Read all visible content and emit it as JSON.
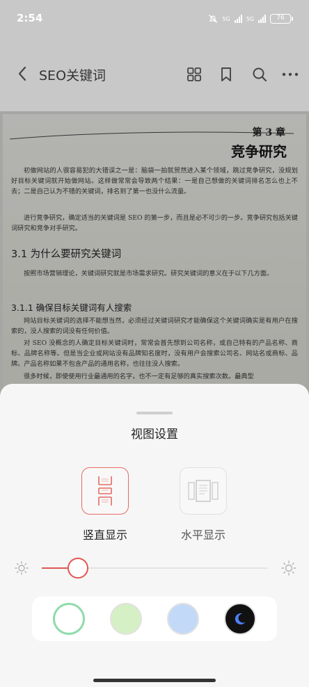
{
  "status": {
    "time": "2:54",
    "net1": "5G",
    "net2": "5G",
    "battery": "76"
  },
  "toolbar": {
    "title": "SEO关键词"
  },
  "book": {
    "chapter_num": "第 3 章",
    "chapter_title": "竞争研究",
    "para1": "初做网站的人很容易犯的大错误之一是：脑袋一拍就贸然进入某个领域，跳过竞争研究，没规划好目标关键词就开始做网站。这样做常常会导致两个结果：一是自己想做的关键词排名怎么也上不去；二是自己认为不错的关键词，排名到了第一也没什么流量。",
    "para2": "进行竞争研究，确定适当的关键词是 SEO 的第一步，而且是必不可少的一步。竞争研究包括关键词研究和竞争对手研究。",
    "h2": "3.1  为什么要研究关键词",
    "para3": "按照市场营销理论，关键词研究就是市场需求研究。研究关键词的意义在于以下几方面。",
    "h3": "3.1.1  确保目标关键词有人搜索",
    "para4": "网站目标关键词的选择不能想当然，必须经过关键词研究才能确保这个关键词确实是有用户在搜索的，没人搜索的词没有任何价值。",
    "para5": "对 SEO 没概念的人确定目标关键词时，常常会首先想到公司名称，或自己特有的产品名称、商标、品牌名称等。但是当企业或网站没有品牌知名度时，没有用户会搜索公司名、网站名或商标、品牌。产品名称如果不包含产品的通用名称，也往往没人搜索。",
    "para6": "很多时候，即使使用行业最通用的名字，也不一定有足够的真实搜索次数。最典型"
  },
  "sheet": {
    "title": "视图设置",
    "mode_vertical": "竖直显示",
    "mode_horizontal": "水平显示",
    "brightness": 0.16
  },
  "colors": {
    "accent": "#e05751",
    "swatches": [
      "#ffffff",
      "#d5f0c4",
      "#c3d9f8",
      "#111111"
    ],
    "swatch_border_selected": "#8fdcaa"
  }
}
